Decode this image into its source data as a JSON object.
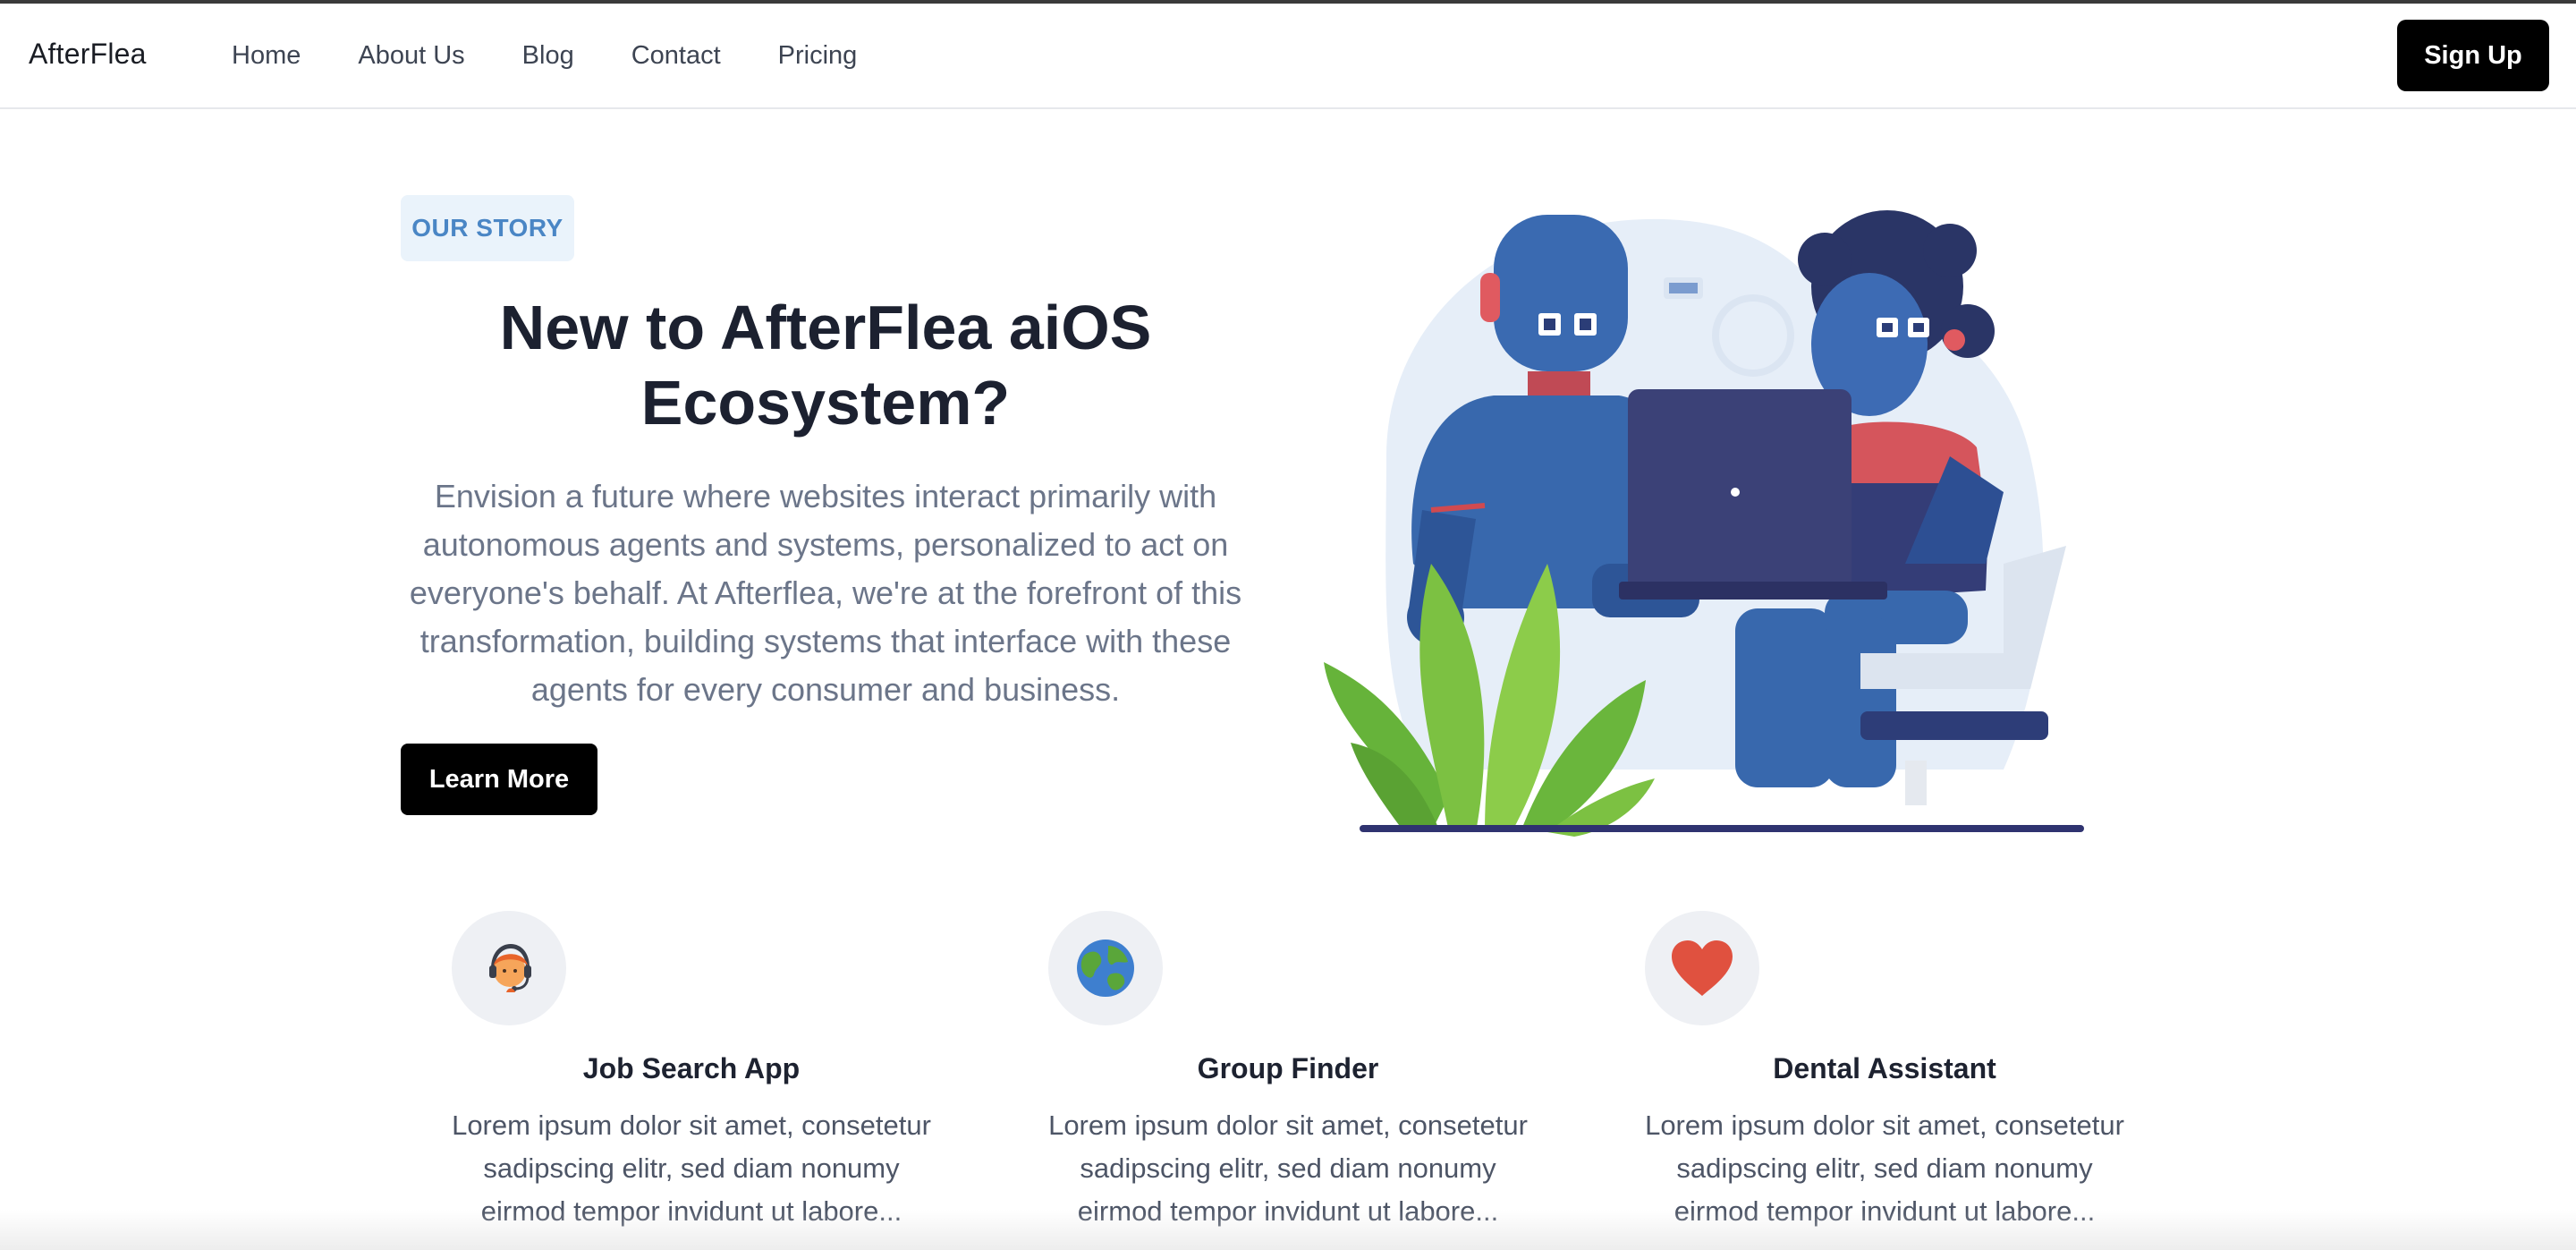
{
  "header": {
    "brand": "AfterFlea",
    "nav": [
      "Home",
      "About Us",
      "Blog",
      "Contact",
      "Pricing"
    ],
    "signup_label": "Sign Up"
  },
  "hero": {
    "eyebrow": "OUR STORY",
    "title_line1": "New to AfterFlea aiOS",
    "title_line2": "Ecosystem?",
    "text_lines": [
      "Envision a future where websites interact primarily with",
      "autonomous agents and systems, personalized to act on",
      "everyone's behalf. At Afterflea, we're at the forefront of this",
      "transformation, building systems that interface with these",
      "agents for every consumer and business."
    ],
    "cta_label": "Learn More"
  },
  "features": [
    {
      "icon": "support-agent-icon",
      "title": "Job Search App",
      "lines": [
        "Lorem ipsum dolor sit amet, consetetur",
        "sadipscing elitr, sed diam nonumy",
        "eirmod tempor invidunt ut labore..."
      ]
    },
    {
      "icon": "globe-icon",
      "title": "Group Finder",
      "lines": [
        "Lorem ipsum dolor sit amet, consetetur",
        "sadipscing elitr, sed diam nonumy",
        "eirmod tempor invidunt ut labore..."
      ]
    },
    {
      "icon": "heart-icon",
      "title": "Dental Assistant",
      "lines": [
        "Lorem ipsum dolor sit amet, consetetur",
        "sadipscing elitr, sed diam nonumy",
        "eirmod tempor invidunt ut labore..."
      ]
    }
  ],
  "colors": {
    "accent_bg": "#eaf3fb",
    "accent_text": "#4a86c5",
    "button_bg": "#000000",
    "heart": "#e0513f"
  }
}
